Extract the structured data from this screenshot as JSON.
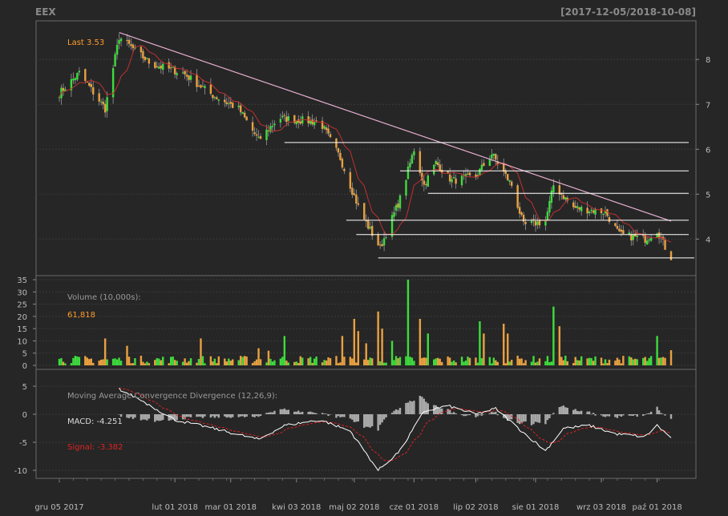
{
  "header": {
    "symbol": "EEX",
    "date_range": "[2017-12-05/2018-10-08]"
  },
  "colors": {
    "background": "#262626",
    "up": "#3ddc3d",
    "down": "#e8a040",
    "sma": "#c03030",
    "trendline": "#e6b0d0",
    "support": "#ffffff",
    "macd": "#ffffff",
    "signal": "#dd2222",
    "hist": "#aaaaaa",
    "axis_text": "#bbbbbb",
    "panel_text": "#9a9a9a",
    "last_label": "#ff9c2c"
  },
  "x_axis": {
    "labels": [
      "gru 05 2017",
      "lut 01 2018",
      "mar 01 2018",
      "kwi 03 2018",
      "maj 02 2018",
      "cze 01 2018",
      "lip 02 2018",
      "sie 01 2018",
      "wrz 03 2018",
      "paź 01 2018"
    ]
  },
  "price_panel": {
    "last_label": "Last 3.53",
    "y_ticks": [
      "4",
      "5",
      "6",
      "7",
      "8"
    ]
  },
  "volume_panel": {
    "title": "Volume (10,000s):",
    "value": "61,818",
    "y_ticks": [
      "0",
      "5",
      "10",
      "15",
      "20",
      "25",
      "30",
      "35"
    ]
  },
  "macd_panel": {
    "title": "Moving Average Convergence Divergence (12,26,9):",
    "macd_label": "MACD: -4.251",
    "signal_label": "Signal: -3.382",
    "y_ticks": [
      "-10",
      "-5",
      "0",
      "5"
    ]
  },
  "chart_data": {
    "type": "candlestick",
    "ticker": "EEX",
    "date_range": [
      "2017-12-05",
      "2018-10-08"
    ],
    "last_close": 3.53,
    "price_ylim": [
      3.4,
      8.7
    ],
    "price_anchors": [
      {
        "date": "2017-12-05",
        "close": 7.25
      },
      {
        "date": "2017-12-15",
        "close": 7.7
      },
      {
        "date": "2017-12-28",
        "close": 6.9
      },
      {
        "date": "2018-01-04",
        "close": 8.5
      },
      {
        "date": "2018-01-20",
        "close": 7.9
      },
      {
        "date": "2018-02-05",
        "close": 7.7
      },
      {
        "date": "2018-02-20",
        "close": 7.2
      },
      {
        "date": "2018-03-05",
        "close": 6.9
      },
      {
        "date": "2018-03-15",
        "close": 6.2
      },
      {
        "date": "2018-03-25",
        "close": 6.7
      },
      {
        "date": "2018-04-15",
        "close": 6.6
      },
      {
        "date": "2018-04-25",
        "close": 5.8
      },
      {
        "date": "2018-05-05",
        "close": 4.6
      },
      {
        "date": "2018-05-15",
        "close": 3.8
      },
      {
        "date": "2018-05-25",
        "close": 4.9
      },
      {
        "date": "2018-06-01",
        "close": 6.0
      },
      {
        "date": "2018-06-06",
        "close": 5.2
      },
      {
        "date": "2018-06-12",
        "close": 5.7
      },
      {
        "date": "2018-06-20",
        "close": 5.3
      },
      {
        "date": "2018-07-02",
        "close": 5.4
      },
      {
        "date": "2018-07-10",
        "close": 5.9
      },
      {
        "date": "2018-07-20",
        "close": 5.2
      },
      {
        "date": "2018-07-26",
        "close": 4.3
      },
      {
        "date": "2018-08-06",
        "close": 4.4
      },
      {
        "date": "2018-08-10",
        "close": 5.2
      },
      {
        "date": "2018-08-20",
        "close": 4.7
      },
      {
        "date": "2018-09-05",
        "close": 4.6
      },
      {
        "date": "2018-09-12",
        "close": 4.1
      },
      {
        "date": "2018-09-25",
        "close": 4.0
      },
      {
        "date": "2018-10-01",
        "close": 4.2
      },
      {
        "date": "2018-10-08",
        "close": 3.53
      }
    ],
    "trendline": {
      "from": {
        "date": "2018-01-04",
        "price": 8.6
      },
      "to": {
        "date": "2018-10-08",
        "price": 4.4
      }
    },
    "support_lines": [
      {
        "price": 6.15,
        "from": "2018-03-28",
        "to": "2018-10-08"
      },
      {
        "price": 5.52,
        "from": "2018-05-25",
        "to": "2018-10-08"
      },
      {
        "price": 5.02,
        "from": "2018-06-08",
        "to": "2018-10-08"
      },
      {
        "price": 4.42,
        "from": "2018-04-28",
        "to": "2018-10-08"
      },
      {
        "price": 4.1,
        "from": "2018-05-03",
        "to": "2018-10-08"
      },
      {
        "price": 3.58,
        "from": "2018-05-14",
        "to": "2018-10-11"
      }
    ],
    "volume_ylim": [
      0,
      36
    ],
    "volume_spikes": [
      {
        "date": "2017-12-28",
        "value": 11
      },
      {
        "date": "2018-01-08",
        "value": 8
      },
      {
        "date": "2018-02-14",
        "value": 11
      },
      {
        "date": "2018-03-15",
        "value": 7
      },
      {
        "date": "2018-03-20",
        "value": 6
      },
      {
        "date": "2018-03-28",
        "value": 12
      },
      {
        "date": "2018-04-26",
        "value": 12
      },
      {
        "date": "2018-05-02",
        "value": 19
      },
      {
        "date": "2018-05-04",
        "value": 14
      },
      {
        "date": "2018-05-08",
        "value": 9
      },
      {
        "date": "2018-05-14",
        "value": 22
      },
      {
        "date": "2018-05-16",
        "value": 15
      },
      {
        "date": "2018-05-21",
        "value": 10
      },
      {
        "date": "2018-05-29",
        "value": 35
      },
      {
        "date": "2018-06-04",
        "value": 19
      },
      {
        "date": "2018-06-08",
        "value": 13
      },
      {
        "date": "2018-07-04",
        "value": 18
      },
      {
        "date": "2018-07-06",
        "value": 13
      },
      {
        "date": "2018-07-16",
        "value": 17
      },
      {
        "date": "2018-07-18",
        "value": 13
      },
      {
        "date": "2018-08-10",
        "value": 24
      },
      {
        "date": "2018-08-13",
        "value": 16
      },
      {
        "date": "2018-10-01",
        "value": 12
      },
      {
        "date": "2018-10-08",
        "value": 6.2
      }
    ],
    "macd_ylim": [
      -11,
      7
    ],
    "macd_anchors": [
      {
        "date": "2018-01-04",
        "value": 4.5
      },
      {
        "date": "2018-01-15",
        "value": 2.5
      },
      {
        "date": "2018-02-01",
        "value": -1.0
      },
      {
        "date": "2018-02-20",
        "value": -2.5
      },
      {
        "date": "2018-03-15",
        "value": -4.5
      },
      {
        "date": "2018-03-28",
        "value": -2.0
      },
      {
        "date": "2018-04-15",
        "value": -1.0
      },
      {
        "date": "2018-04-30",
        "value": -3.0
      },
      {
        "date": "2018-05-14",
        "value": -10.0
      },
      {
        "date": "2018-05-25",
        "value": -6.5
      },
      {
        "date": "2018-06-06",
        "value": 0.5
      },
      {
        "date": "2018-06-18",
        "value": 1.5
      },
      {
        "date": "2018-07-02",
        "value": 0.0
      },
      {
        "date": "2018-07-12",
        "value": 1.0
      },
      {
        "date": "2018-07-25",
        "value": -3.0
      },
      {
        "date": "2018-08-06",
        "value": -6.5
      },
      {
        "date": "2018-08-15",
        "value": -2.5
      },
      {
        "date": "2018-08-28",
        "value": -2.0
      },
      {
        "date": "2018-09-10",
        "value": -3.5
      },
      {
        "date": "2018-09-25",
        "value": -4.0
      },
      {
        "date": "2018-10-01",
        "value": -2.0
      },
      {
        "date": "2018-10-08",
        "value": -4.251
      }
    ],
    "signal_last": -3.382
  }
}
